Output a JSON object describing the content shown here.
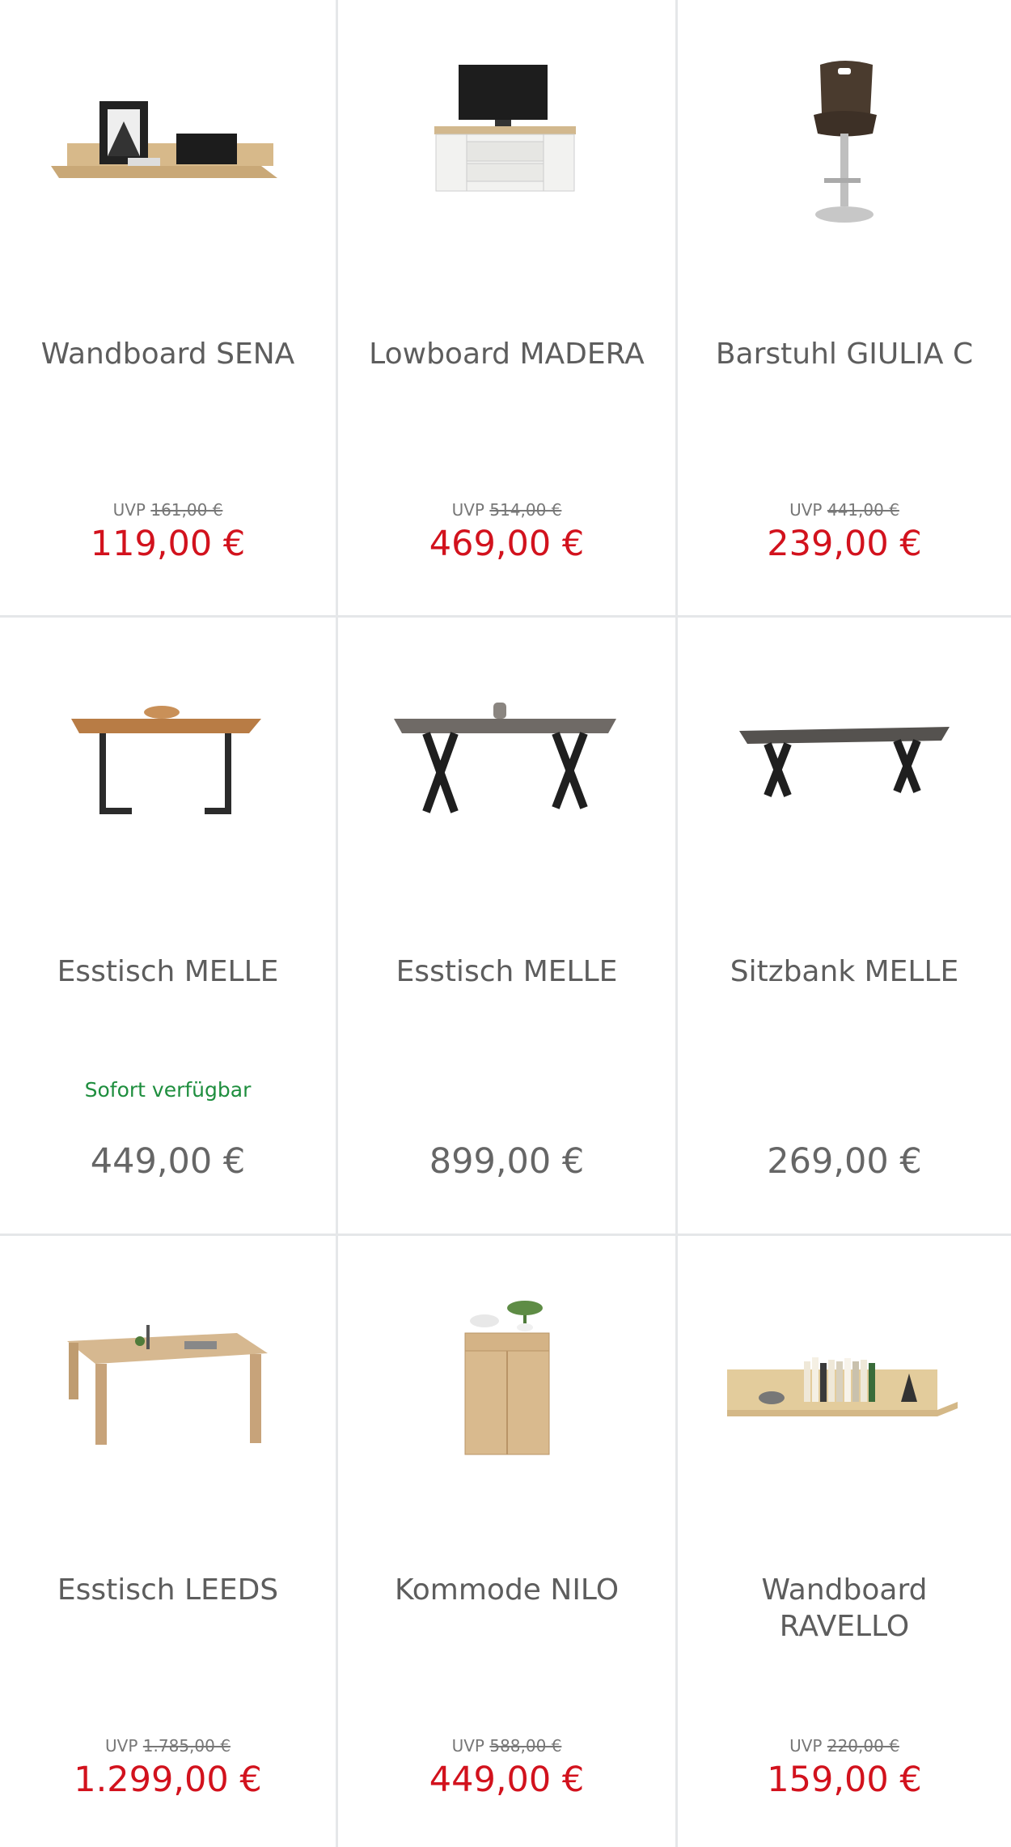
{
  "products": [
    {
      "name": "Wandboard SENA",
      "uvp_label": "UVP",
      "uvp_price": "161,00 €",
      "price": "119,00 €",
      "availability": "",
      "image": "wall-shelf-image"
    },
    {
      "name": "Lowboard MADERA",
      "uvp_label": "UVP",
      "uvp_price": "514,00 €",
      "price": "469,00 €",
      "availability": "",
      "image": "tv-lowboard-image"
    },
    {
      "name": "Barstuhl GIULIA C",
      "uvp_label": "UVP",
      "uvp_price": "441,00 €",
      "price": "239,00 €",
      "availability": "",
      "image": "bar-stool-image"
    },
    {
      "name": "Esstisch MELLE",
      "uvp_label": "",
      "uvp_price": "",
      "price": "449,00 €",
      "availability": "Sofort verfügbar",
      "image": "dining-table-image"
    },
    {
      "name": "Esstisch MELLE",
      "uvp_label": "",
      "uvp_price": "",
      "price": "899,00 €",
      "availability": "",
      "image": "dining-table-x-legs-image"
    },
    {
      "name": "Sitzbank MELLE",
      "uvp_label": "",
      "uvp_price": "",
      "price": "269,00 €",
      "availability": "",
      "image": "bench-image"
    },
    {
      "name": "Esstisch LEEDS",
      "uvp_label": "UVP",
      "uvp_price": "1.785,00 €",
      "price": "1.299,00 €",
      "availability": "",
      "image": "oak-dining-table-image"
    },
    {
      "name": "Kommode NILO",
      "uvp_label": "UVP",
      "uvp_price": "588,00 €",
      "price": "449,00 €",
      "availability": "",
      "image": "chest-of-drawers-image"
    },
    {
      "name": "Wandboard RAVELLO",
      "uvp_label": "UVP",
      "uvp_price": "220,00 €",
      "price": "159,00 €",
      "availability": "",
      "image": "wall-shelf-books-image"
    }
  ],
  "colors": {
    "sale_price": "#d2121d",
    "regular_price": "#666666",
    "availability": "#1e8e3e",
    "divider": "#e5e7e9"
  }
}
